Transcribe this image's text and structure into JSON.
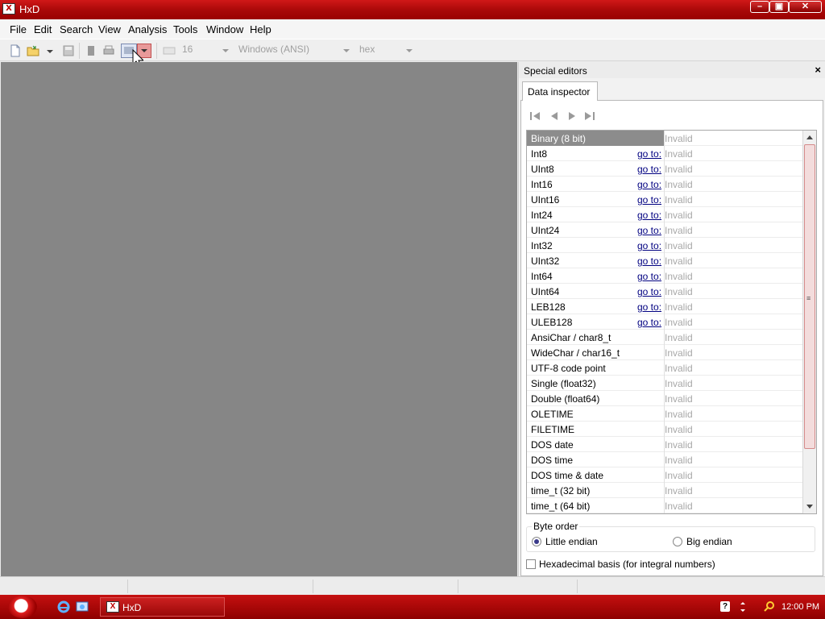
{
  "window": {
    "title": "HxD",
    "app_icon_letter": "X"
  },
  "menu": [
    "File",
    "Edit",
    "Search",
    "View",
    "Analysis",
    "Tools",
    "Window",
    "Help"
  ],
  "toolbar": {
    "bytes_per_row": "16",
    "charset": "Windows (ANSI)",
    "offset_base": "hex"
  },
  "panel": {
    "title": "Special editors",
    "close": "×",
    "tab": "Data inspector"
  },
  "inspector": {
    "goto_label": "go to:",
    "rows": [
      {
        "name": "Binary (8 bit)",
        "has_goto": false,
        "value": "Invalid"
      },
      {
        "name": "Int8",
        "has_goto": true,
        "value": "Invalid"
      },
      {
        "name": "UInt8",
        "has_goto": true,
        "value": "Invalid"
      },
      {
        "name": "Int16",
        "has_goto": true,
        "value": "Invalid"
      },
      {
        "name": "UInt16",
        "has_goto": true,
        "value": "Invalid"
      },
      {
        "name": "Int24",
        "has_goto": true,
        "value": "Invalid"
      },
      {
        "name": "UInt24",
        "has_goto": true,
        "value": "Invalid"
      },
      {
        "name": "Int32",
        "has_goto": true,
        "value": "Invalid"
      },
      {
        "name": "UInt32",
        "has_goto": true,
        "value": "Invalid"
      },
      {
        "name": "Int64",
        "has_goto": true,
        "value": "Invalid"
      },
      {
        "name": "UInt64",
        "has_goto": true,
        "value": "Invalid"
      },
      {
        "name": "LEB128",
        "has_goto": true,
        "value": "Invalid"
      },
      {
        "name": "ULEB128",
        "has_goto": true,
        "value": "Invalid"
      },
      {
        "name": "AnsiChar / char8_t",
        "has_goto": false,
        "value": "Invalid"
      },
      {
        "name": "WideChar / char16_t",
        "has_goto": false,
        "value": "Invalid"
      },
      {
        "name": "UTF-8 code point",
        "has_goto": false,
        "value": "Invalid"
      },
      {
        "name": "Single (float32)",
        "has_goto": false,
        "value": "Invalid"
      },
      {
        "name": "Double (float64)",
        "has_goto": false,
        "value": "Invalid"
      },
      {
        "name": "OLETIME",
        "has_goto": false,
        "value": "Invalid"
      },
      {
        "name": "FILETIME",
        "has_goto": false,
        "value": "Invalid"
      },
      {
        "name": "DOS date",
        "has_goto": false,
        "value": "Invalid"
      },
      {
        "name": "DOS time",
        "has_goto": false,
        "value": "Invalid"
      },
      {
        "name": "DOS time & date",
        "has_goto": false,
        "value": "Invalid"
      },
      {
        "name": "time_t (32 bit)",
        "has_goto": false,
        "value": "Invalid"
      },
      {
        "name": "time_t (64 bit)",
        "has_goto": false,
        "value": "Invalid"
      }
    ]
  },
  "byte_order": {
    "legend": "Byte order",
    "little": "Little endian",
    "big": "Big endian",
    "selected": "little"
  },
  "hex_basis": {
    "label": "Hexadecimal basis (for integral numbers)",
    "checked": false
  },
  "taskbar": {
    "task_label": "HxD",
    "clock": "12:00 PM",
    "help": "?"
  },
  "colors": {
    "accent": "#b00000",
    "editor_bg": "#868686",
    "invalid_text": "#a8a8a8"
  }
}
